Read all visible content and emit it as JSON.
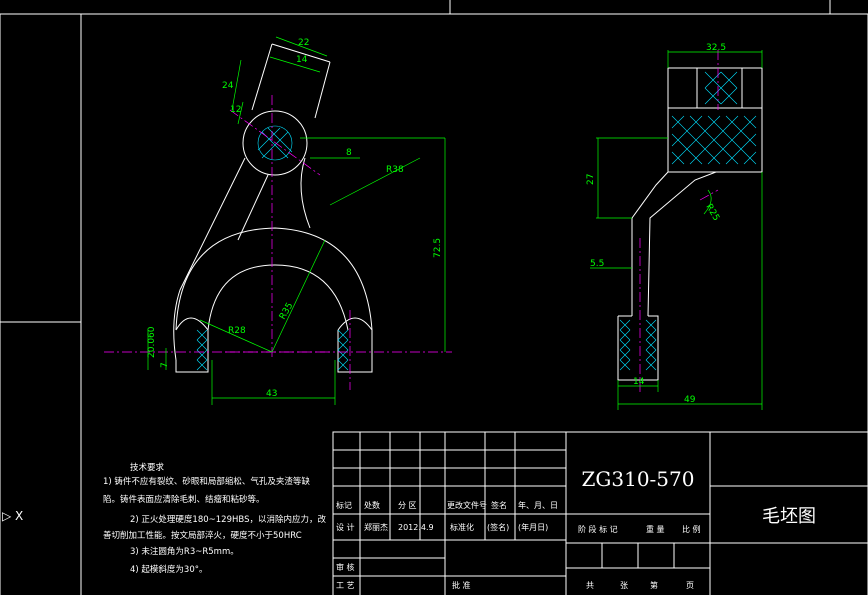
{
  "drawing": {
    "part_number": "ZG310-570",
    "title": "毛坯图",
    "left_marker": "▷ X"
  },
  "front_view": {
    "dims": {
      "top_width": "22",
      "boss_width": "14",
      "slot_angle": "24",
      "slot_depth": "12",
      "offset": "8",
      "arc_radius": "R38",
      "height": "72.5",
      "fork_inner": "R35",
      "fork_radius": "R28",
      "jaw_height": "20.060",
      "jaw_small": "7",
      "width": "43"
    }
  },
  "side_view": {
    "dims": {
      "top_width": "32.5",
      "offset": "27",
      "radius": "R25",
      "stem": "5.5",
      "bottom_width": "14",
      "total_width": "49"
    }
  },
  "tech_requirements": {
    "heading": "技术要求",
    "lines": [
      "1) 铸件不应有裂纹、砂眼和局部缩松、气孔及夹渣等缺",
      "陷。铸件表面应清除毛刺、结瘤和粘砂等。",
      "2) 正火处理硬度180~129HBS，以消除内应力，改",
      "善切削加工性能。按文局部淬火，硬度不小于50HRC",
      "3) 未注圆角为R3~R5mm。",
      "4) 起模斜度为30°。"
    ]
  },
  "title_block": {
    "row_marks": [
      "标记",
      "处数",
      "分 区",
      "更改文件号",
      "签名",
      "年、月、日"
    ],
    "row_design": [
      "设 计",
      "郑丽杰",
      "2012.4.9",
      "标准化",
      "(签名)",
      "(年月日)"
    ],
    "stage_labels": [
      "阶 段 标 记",
      "重 量",
      "比 例"
    ],
    "review": "审 核",
    "process": "工 艺",
    "approve": "批 准",
    "sheets": [
      "共",
      "张",
      "第",
      "页"
    ]
  }
}
